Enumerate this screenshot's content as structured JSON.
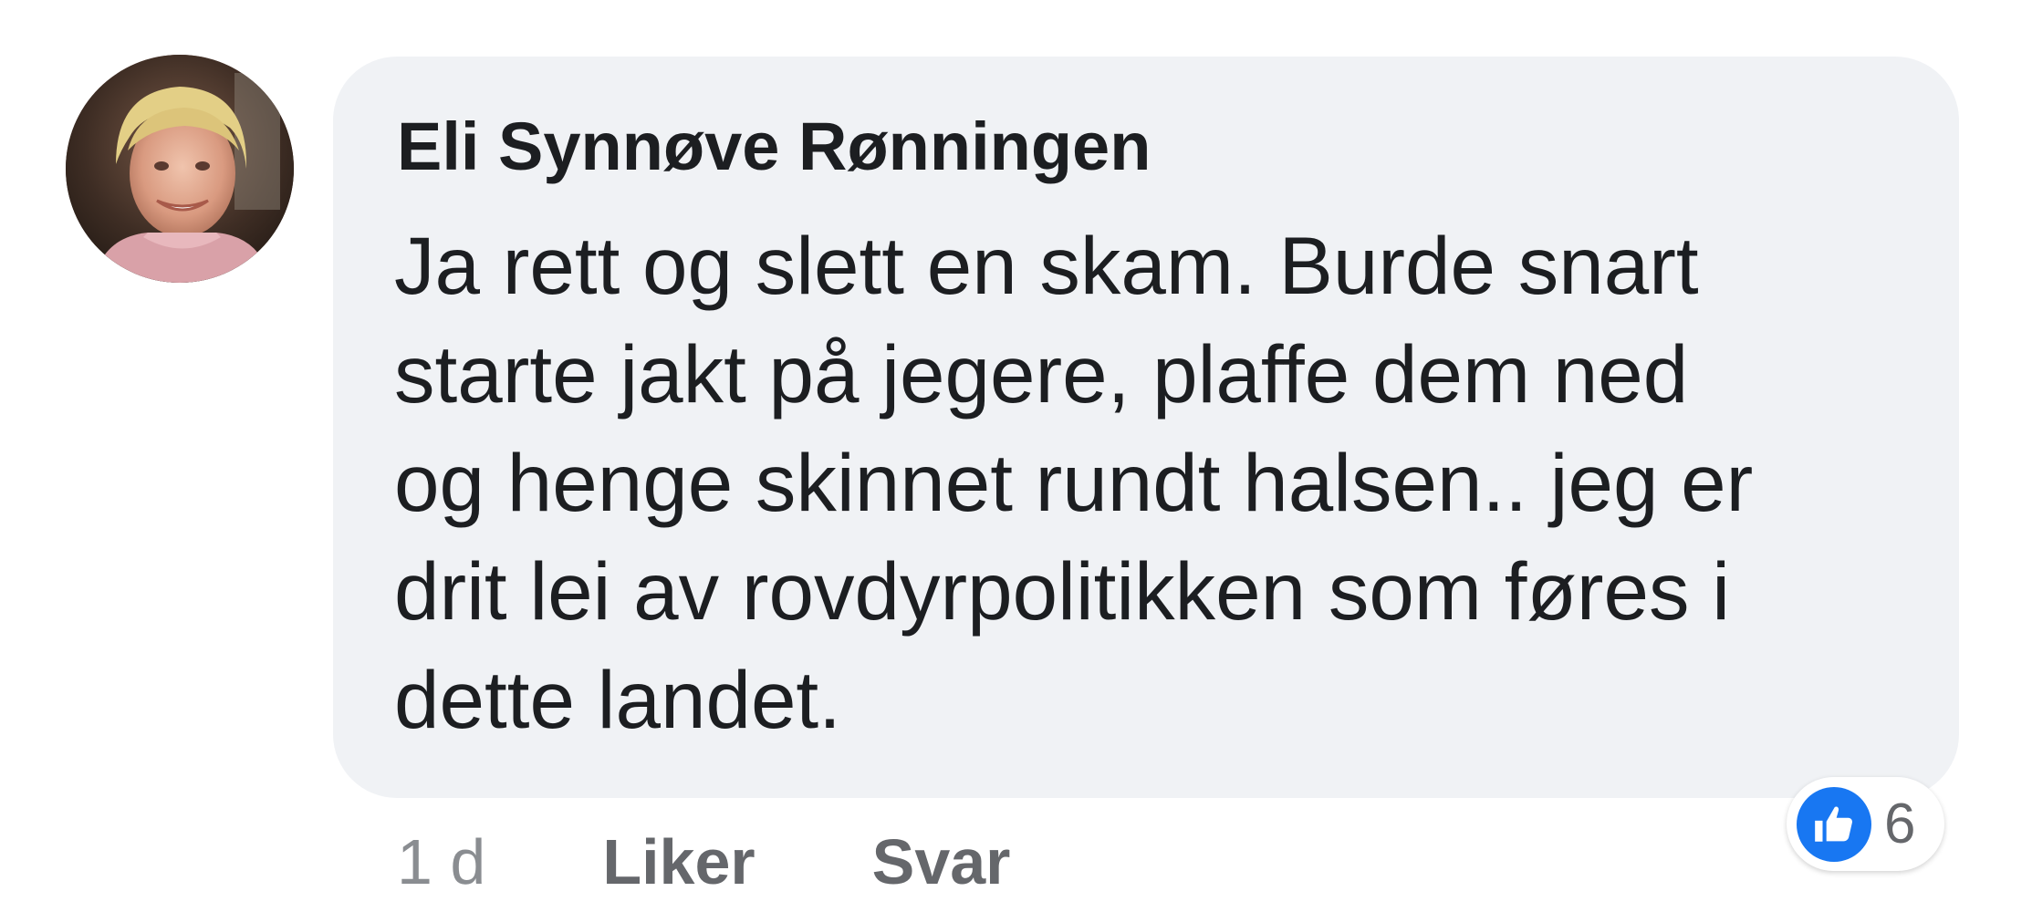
{
  "comment": {
    "author": "Eli Synnøve Rønningen",
    "text_lines": [
      "Ja rett og slett en skam. Burde snart",
      "starte jakt på jegere, plaffe dem ned",
      "og henge skinnet rundt halsen.. jeg er",
      "drit lei av rovdyrpolitikken som føres i",
      "dette landet."
    ],
    "timestamp": "1 d",
    "like_label": "Liker",
    "reply_label": "Svar",
    "reactions": {
      "icon": "thumbs-up-icon",
      "count": "6",
      "color": "#1877f2"
    },
    "avatar_icon": "profile-photo"
  },
  "colors": {
    "bubble": "#f0f2f5",
    "text": "#1c1e21",
    "meta": "#65676b"
  }
}
